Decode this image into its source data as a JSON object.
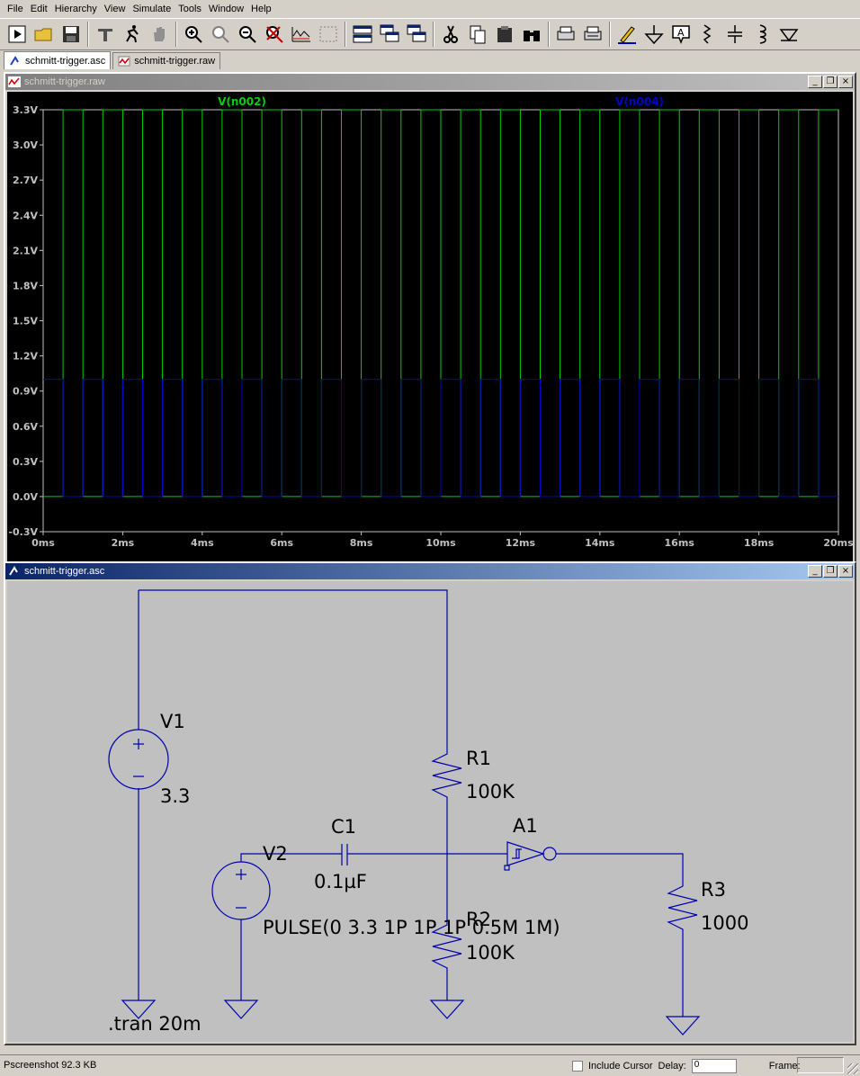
{
  "menu": [
    "File",
    "Edit",
    "Hierarchy",
    "View",
    "Simulate",
    "Tools",
    "Window",
    "Help"
  ],
  "tabs": [
    {
      "label": "schmitt-trigger.asc",
      "icon": "schematic-icon",
      "active": true
    },
    {
      "label": "schmitt-trigger.raw",
      "icon": "waveform-icon",
      "active": false
    }
  ],
  "toolbar_icons": [
    "run-icon",
    "open-icon",
    "save-icon",
    "control-panel-icon",
    "run-man-icon",
    "halt-hand-icon",
    "zoom-in-icon",
    "pan-icon",
    "zoom-out-icon",
    "zoom-cancel-icon",
    "autorange-icon",
    "sheet-icon",
    "tile-horizontal-icon",
    "cascade-icon",
    "tile-vertical-icon",
    "cut-icon",
    "copy-icon",
    "paste-icon",
    "find-icon",
    "print-setup-icon",
    "print-icon",
    "wire-pencil-icon",
    "ground-icon",
    "label-net-icon",
    "resistor-icon",
    "capacitor-icon",
    "inductor-icon",
    "diode-icon"
  ],
  "waveform_window": {
    "title": "schmitt-trigger.raw"
  },
  "schematic_window": {
    "title": "schmitt-trigger.asc"
  },
  "window_buttons": {
    "minimize": "_",
    "restore": "❐",
    "close": "×"
  },
  "chart_data": {
    "type": "line",
    "title": "",
    "xlabel": "",
    "ylabel": "",
    "xlim": [
      0,
      20
    ],
    "ylim": [
      -0.3,
      3.3
    ],
    "x_ticks": [
      "0ms",
      "2ms",
      "4ms",
      "6ms",
      "8ms",
      "10ms",
      "12ms",
      "14ms",
      "16ms",
      "18ms",
      "20ms"
    ],
    "y_ticks": [
      "3.3V",
      "3.0V",
      "2.7V",
      "2.4V",
      "2.1V",
      "1.8V",
      "1.5V",
      "1.2V",
      "0.9V",
      "0.6V",
      "0.3V",
      "0.0V",
      "-0.3V"
    ],
    "series": [
      {
        "name": "V(n002)",
        "color": "#00d000",
        "low": 0,
        "high": 3.3,
        "period_ms": 1.0,
        "high_width_ms": 0.5,
        "phase": "low-first"
      },
      {
        "name": "V(n004)",
        "color": "#0000d0",
        "low": 0,
        "high": 1.0,
        "period_ms": 1.0,
        "high_width_ms": 0.5,
        "phase": "high-first"
      }
    ],
    "grid": false,
    "legend": "top"
  },
  "schematic": {
    "labels": {
      "v1": "V1",
      "v1_value": "3.3",
      "r1": "R1",
      "r1_value": "100K",
      "c1": "C1",
      "c1_value": "0.1µF",
      "a1": "A1",
      "v2": "V2",
      "v2_value": "PULSE(0 3.3 1P 1P 1P 0.5M 1M)",
      "r2": "R2",
      "r2_value": "100K",
      "r3": "R3",
      "r3_value": "1000",
      "directive": ".tran 20m"
    },
    "wire_color": "#0000b0"
  },
  "status": {
    "text": "Pscreenshot  92.3 KB",
    "include_cursor": "Include Cursor",
    "delay_label": "Delay:",
    "delay_value": "0",
    "frame_label": "Frame:"
  }
}
